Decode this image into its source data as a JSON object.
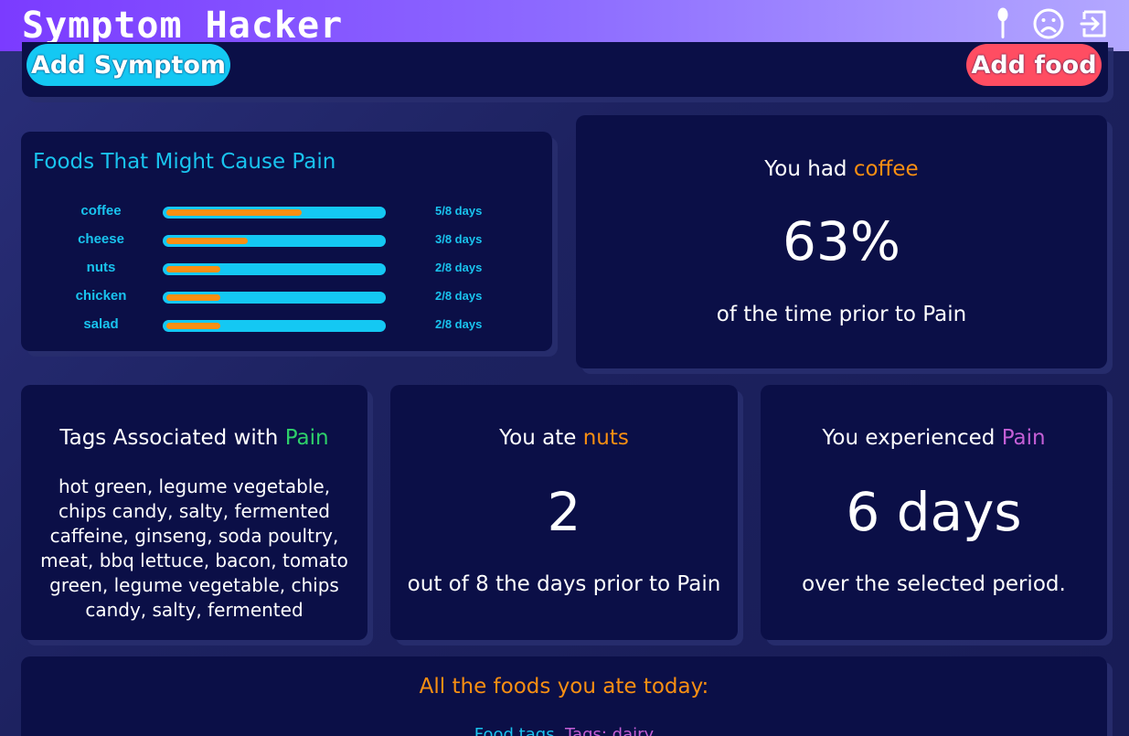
{
  "app": {
    "title": "Symptom Hacker"
  },
  "header": {
    "icons": [
      "spoon-icon",
      "sad-face-icon",
      "logout-icon"
    ]
  },
  "actions": {
    "add_symptom": "Add Symptom",
    "add_food": "Add food"
  },
  "foods_panel": {
    "title": "Foods That Might Cause Pain",
    "items": [
      {
        "name": "coffee",
        "days": "5/8 days",
        "fraction": 0.625
      },
      {
        "name": "cheese",
        "days": "3/8 days",
        "fraction": 0.375
      },
      {
        "name": "nuts",
        "days": "2/8 days",
        "fraction": 0.25
      },
      {
        "name": "chicken",
        "days": "2/8 days",
        "fraction": 0.25
      },
      {
        "name": "salad",
        "days": "2/8 days",
        "fraction": 0.25
      }
    ]
  },
  "coffee_stat": {
    "prefix": "You had ",
    "food": "coffee",
    "value": "63%",
    "sub": "of the time prior to Pain"
  },
  "tags_stat": {
    "prefix": "Tags Associated with ",
    "symptom": "Pain",
    "body": "hot green, legume vegetable, chips candy, salty, fermented caffeine, ginseng, soda poultry, meat, bbq lettuce, bacon, tomato green, legume vegetable, chips candy, salty, fermented"
  },
  "nuts_stat": {
    "prefix": "You ate ",
    "food": "nuts",
    "value": "2",
    "sub": "out of 8 the days prior to Pain"
  },
  "pain_stat": {
    "prefix": "You experienced ",
    "symptom": "Pain",
    "value": "6 days",
    "sub": "over the selected period."
  },
  "today": {
    "title": "All the foods you ate today:",
    "food_tags": "Food tags",
    "tags": "Tags: dairy"
  },
  "colors": {
    "accent_cyan": "#14c8f3",
    "accent_orange": "#f98f12",
    "accent_red": "#ff4d62",
    "accent_green": "#2ed06a",
    "accent_purple": "#c45fd6",
    "card_bg": "#0b0f47"
  }
}
